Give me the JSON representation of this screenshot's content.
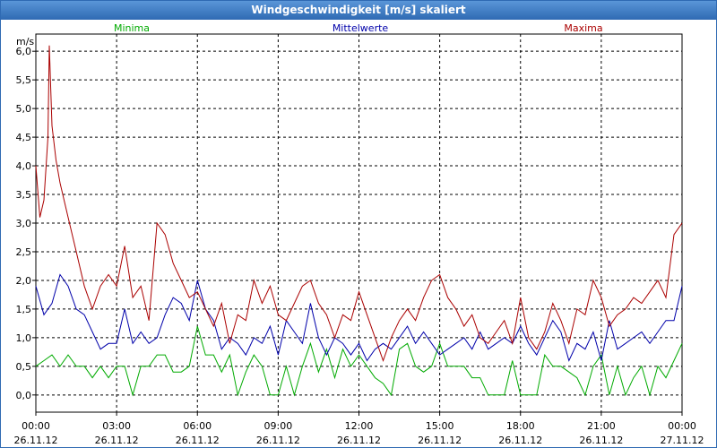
{
  "window": {
    "title": "Windgeschwindigkeit [m/s] skaliert"
  },
  "chart_data": {
    "type": "line",
    "title": "Windgeschwindigkeit [m/s] skaliert",
    "ylabel": "m/s",
    "xlabel": "",
    "ylim": [
      -0.3,
      6.3
    ],
    "xlim": [
      0,
      24
    ],
    "grid": true,
    "legend_position": "top",
    "y_ticks": [
      "0,0",
      "0,5",
      "1,0",
      "1,5",
      "2,0",
      "2,5",
      "3,0",
      "3,5",
      "4,0",
      "4,5",
      "5,0",
      "5,5",
      "6,0"
    ],
    "x_ticks": [
      {
        "time": "00:00",
        "date": "26.11.12"
      },
      {
        "time": "03:00",
        "date": "26.11.12"
      },
      {
        "time": "06:00",
        "date": "26.11.12"
      },
      {
        "time": "09:00",
        "date": "26.11.12"
      },
      {
        "time": "12:00",
        "date": "26.11.12"
      },
      {
        "time": "15:00",
        "date": "26.11.12"
      },
      {
        "time": "18:00",
        "date": "26.11.12"
      },
      {
        "time": "21:00",
        "date": "26.11.12"
      },
      {
        "time": "00:00",
        "date": "27.11.12"
      }
    ],
    "series": [
      {
        "name": "Minima",
        "color": "#00aa00",
        "points": [
          [
            0,
            0.5
          ],
          [
            0.3,
            0.6
          ],
          [
            0.6,
            0.7
          ],
          [
            0.9,
            0.5
          ],
          [
            1.2,
            0.7
          ],
          [
            1.5,
            0.5
          ],
          [
            1.8,
            0.5
          ],
          [
            2.1,
            0.3
          ],
          [
            2.4,
            0.5
          ],
          [
            2.7,
            0.3
          ],
          [
            3.0,
            0.5
          ],
          [
            3.3,
            0.5
          ],
          [
            3.6,
            0.0
          ],
          [
            3.9,
            0.5
          ],
          [
            4.2,
            0.5
          ],
          [
            4.5,
            0.7
          ],
          [
            4.8,
            0.7
          ],
          [
            5.1,
            0.4
          ],
          [
            5.4,
            0.4
          ],
          [
            5.7,
            0.5
          ],
          [
            6.0,
            1.2
          ],
          [
            6.3,
            0.7
          ],
          [
            6.6,
            0.7
          ],
          [
            6.9,
            0.4
          ],
          [
            7.2,
            0.7
          ],
          [
            7.5,
            0.0
          ],
          [
            7.8,
            0.4
          ],
          [
            8.1,
            0.7
          ],
          [
            8.4,
            0.5
          ],
          [
            8.7,
            0.0
          ],
          [
            9.0,
            0.0
          ],
          [
            9.3,
            0.5
          ],
          [
            9.6,
            0.0
          ],
          [
            9.9,
            0.5
          ],
          [
            10.2,
            0.9
          ],
          [
            10.5,
            0.4
          ],
          [
            10.8,
            0.8
          ],
          [
            11.1,
            0.3
          ],
          [
            11.4,
            0.8
          ],
          [
            11.7,
            0.5
          ],
          [
            12.0,
            0.7
          ],
          [
            12.3,
            0.5
          ],
          [
            12.6,
            0.3
          ],
          [
            12.9,
            0.2
          ],
          [
            13.2,
            0.0
          ],
          [
            13.5,
            0.8
          ],
          [
            13.8,
            0.9
          ],
          [
            14.1,
            0.5
          ],
          [
            14.4,
            0.4
          ],
          [
            14.7,
            0.5
          ],
          [
            15.0,
            0.9
          ],
          [
            15.3,
            0.5
          ],
          [
            15.6,
            0.5
          ],
          [
            15.9,
            0.5
          ],
          [
            16.2,
            0.3
          ],
          [
            16.5,
            0.3
          ],
          [
            16.8,
            0.0
          ],
          [
            17.1,
            0.0
          ],
          [
            17.4,
            0.0
          ],
          [
            17.7,
            0.6
          ],
          [
            18.0,
            0.0
          ],
          [
            18.3,
            0.0
          ],
          [
            18.6,
            0.0
          ],
          [
            18.9,
            0.7
          ],
          [
            19.2,
            0.5
          ],
          [
            19.5,
            0.5
          ],
          [
            19.8,
            0.4
          ],
          [
            20.1,
            0.3
          ],
          [
            20.4,
            0.0
          ],
          [
            20.7,
            0.5
          ],
          [
            21.0,
            0.7
          ],
          [
            21.3,
            0.0
          ],
          [
            21.6,
            0.5
          ],
          [
            21.9,
            0.0
          ],
          [
            22.2,
            0.3
          ],
          [
            22.5,
            0.5
          ],
          [
            22.8,
            0.0
          ],
          [
            23.1,
            0.5
          ],
          [
            23.4,
            0.3
          ],
          [
            23.7,
            0.6
          ],
          [
            24.0,
            0.9
          ]
        ]
      },
      {
        "name": "Mittelwerte",
        "color": "#0000aa",
        "points": [
          [
            0,
            1.9
          ],
          [
            0.3,
            1.4
          ],
          [
            0.6,
            1.6
          ],
          [
            0.9,
            2.1
          ],
          [
            1.2,
            1.9
          ],
          [
            1.5,
            1.5
          ],
          [
            1.8,
            1.4
          ],
          [
            2.1,
            1.1
          ],
          [
            2.4,
            0.8
          ],
          [
            2.7,
            0.9
          ],
          [
            3.0,
            0.9
          ],
          [
            3.3,
            1.5
          ],
          [
            3.6,
            0.9
          ],
          [
            3.9,
            1.1
          ],
          [
            4.2,
            0.9
          ],
          [
            4.5,
            1.0
          ],
          [
            4.8,
            1.4
          ],
          [
            5.1,
            1.7
          ],
          [
            5.4,
            1.6
          ],
          [
            5.7,
            1.3
          ],
          [
            6.0,
            2.0
          ],
          [
            6.3,
            1.5
          ],
          [
            6.6,
            1.3
          ],
          [
            6.9,
            0.8
          ],
          [
            7.2,
            1.0
          ],
          [
            7.5,
            0.9
          ],
          [
            7.8,
            0.7
          ],
          [
            8.1,
            1.0
          ],
          [
            8.4,
            0.9
          ],
          [
            8.7,
            1.2
          ],
          [
            9.0,
            0.7
          ],
          [
            9.3,
            1.3
          ],
          [
            9.6,
            1.1
          ],
          [
            9.9,
            0.9
          ],
          [
            10.2,
            1.6
          ],
          [
            10.5,
            1.0
          ],
          [
            10.8,
            0.7
          ],
          [
            11.1,
            1.0
          ],
          [
            11.4,
            0.9
          ],
          [
            11.7,
            0.7
          ],
          [
            12.0,
            0.9
          ],
          [
            12.3,
            0.6
          ],
          [
            12.6,
            0.8
          ],
          [
            12.9,
            0.9
          ],
          [
            13.2,
            0.8
          ],
          [
            13.5,
            1.0
          ],
          [
            13.8,
            1.2
          ],
          [
            14.1,
            0.9
          ],
          [
            14.4,
            1.1
          ],
          [
            14.7,
            0.9
          ],
          [
            15.0,
            0.7
          ],
          [
            15.3,
            0.8
          ],
          [
            15.6,
            0.9
          ],
          [
            15.9,
            1.0
          ],
          [
            16.2,
            0.8
          ],
          [
            16.5,
            1.1
          ],
          [
            16.8,
            0.8
          ],
          [
            17.1,
            0.9
          ],
          [
            17.4,
            1.0
          ],
          [
            17.7,
            0.9
          ],
          [
            18.0,
            1.2
          ],
          [
            18.3,
            0.9
          ],
          [
            18.6,
            0.7
          ],
          [
            18.9,
            1.0
          ],
          [
            19.2,
            1.3
          ],
          [
            19.5,
            1.1
          ],
          [
            19.8,
            0.6
          ],
          [
            20.1,
            0.9
          ],
          [
            20.4,
            0.8
          ],
          [
            20.7,
            1.1
          ],
          [
            21.0,
            0.6
          ],
          [
            21.3,
            1.3
          ],
          [
            21.6,
            0.8
          ],
          [
            21.9,
            0.9
          ],
          [
            22.2,
            1.0
          ],
          [
            22.5,
            1.1
          ],
          [
            22.8,
            0.9
          ],
          [
            23.1,
            1.1
          ],
          [
            23.4,
            1.3
          ],
          [
            23.7,
            1.3
          ],
          [
            24.0,
            1.9
          ]
        ]
      },
      {
        "name": "Maxima",
        "color": "#aa0000",
        "points": [
          [
            0,
            4.0
          ],
          [
            0.15,
            3.1
          ],
          [
            0.3,
            3.4
          ],
          [
            0.45,
            4.5
          ],
          [
            0.5,
            6.1
          ],
          [
            0.6,
            4.7
          ],
          [
            0.75,
            4.1
          ],
          [
            0.9,
            3.7
          ],
          [
            1.05,
            3.4
          ],
          [
            1.2,
            3.1
          ],
          [
            1.5,
            2.5
          ],
          [
            1.8,
            1.9
          ],
          [
            2.1,
            1.5
          ],
          [
            2.4,
            1.9
          ],
          [
            2.7,
            2.1
          ],
          [
            3.0,
            1.9
          ],
          [
            3.3,
            2.6
          ],
          [
            3.6,
            1.7
          ],
          [
            3.9,
            1.9
          ],
          [
            4.2,
            1.3
          ],
          [
            4.5,
            3.0
          ],
          [
            4.8,
            2.8
          ],
          [
            5.1,
            2.3
          ],
          [
            5.4,
            2.0
          ],
          [
            5.7,
            1.7
          ],
          [
            6.0,
            1.8
          ],
          [
            6.3,
            1.5
          ],
          [
            6.6,
            1.2
          ],
          [
            6.9,
            1.6
          ],
          [
            7.2,
            0.9
          ],
          [
            7.5,
            1.4
          ],
          [
            7.8,
            1.3
          ],
          [
            8.1,
            2.0
          ],
          [
            8.4,
            1.6
          ],
          [
            8.7,
            1.9
          ],
          [
            9.0,
            1.4
          ],
          [
            9.3,
            1.3
          ],
          [
            9.6,
            1.6
          ],
          [
            9.9,
            1.9
          ],
          [
            10.2,
            2.0
          ],
          [
            10.5,
            1.6
          ],
          [
            10.8,
            1.4
          ],
          [
            11.1,
            1.0
          ],
          [
            11.4,
            1.4
          ],
          [
            11.7,
            1.3
          ],
          [
            12.0,
            1.8
          ],
          [
            12.3,
            1.4
          ],
          [
            12.6,
            1.0
          ],
          [
            12.9,
            0.6
          ],
          [
            13.2,
            1.0
          ],
          [
            13.5,
            1.3
          ],
          [
            13.8,
            1.5
          ],
          [
            14.1,
            1.3
          ],
          [
            14.4,
            1.7
          ],
          [
            14.7,
            2.0
          ],
          [
            15.0,
            2.1
          ],
          [
            15.3,
            1.7
          ],
          [
            15.6,
            1.5
          ],
          [
            15.9,
            1.2
          ],
          [
            16.2,
            1.4
          ],
          [
            16.5,
            1.0
          ],
          [
            16.8,
            0.9
          ],
          [
            17.1,
            1.1
          ],
          [
            17.4,
            1.3
          ],
          [
            17.7,
            0.9
          ],
          [
            18.0,
            1.7
          ],
          [
            18.3,
            1.0
          ],
          [
            18.6,
            0.8
          ],
          [
            18.9,
            1.1
          ],
          [
            19.2,
            1.6
          ],
          [
            19.5,
            1.3
          ],
          [
            19.8,
            0.9
          ],
          [
            20.1,
            1.5
          ],
          [
            20.4,
            1.4
          ],
          [
            20.7,
            2.0
          ],
          [
            21.0,
            1.7
          ],
          [
            21.3,
            1.2
          ],
          [
            21.6,
            1.4
          ],
          [
            21.9,
            1.5
          ],
          [
            22.2,
            1.7
          ],
          [
            22.5,
            1.6
          ],
          [
            22.8,
            1.8
          ],
          [
            23.1,
            2.0
          ],
          [
            23.4,
            1.7
          ],
          [
            23.7,
            2.8
          ],
          [
            24.0,
            3.0
          ]
        ]
      }
    ]
  }
}
